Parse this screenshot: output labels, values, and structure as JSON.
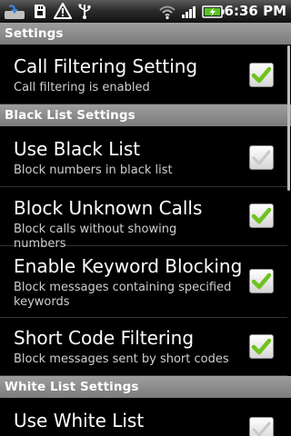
{
  "status_bar": {
    "time": "6:36 PM",
    "icons": [
      "app-notification-icon",
      "sd-card-icon",
      "warning-icon",
      "usb-icon",
      "wifi-icon",
      "signal-icon",
      "battery-charging-icon"
    ]
  },
  "sections": [
    {
      "label": "Settings"
    },
    {
      "label": "Black List Settings"
    },
    {
      "label": "White List Settings"
    }
  ],
  "preferences": {
    "call_filtering": {
      "title": "Call Filtering Setting",
      "summary": "Call filtering is enabled",
      "checked": true
    },
    "use_black_list": {
      "title": "Use Black List",
      "summary": "Block numbers in black list",
      "checked": false
    },
    "block_unknown": {
      "title": "Block Unknown Calls",
      "summary": "Block calls without showing numbers",
      "checked": true
    },
    "keyword_blocking": {
      "title": "Enable Keyword Blocking",
      "summary": "Block messages containing specified keywords",
      "checked": true
    },
    "short_code": {
      "title": "Short Code Filtering",
      "summary": "Block messages sent by short codes",
      "checked": true
    },
    "use_white_list": {
      "title": "Use White List",
      "summary": "",
      "checked": false
    }
  },
  "colors": {
    "check_green": "#6fc21f",
    "check_grey": "#c8c8c8",
    "header_bg": "#8c8c8c",
    "battery_green": "#58c322"
  }
}
